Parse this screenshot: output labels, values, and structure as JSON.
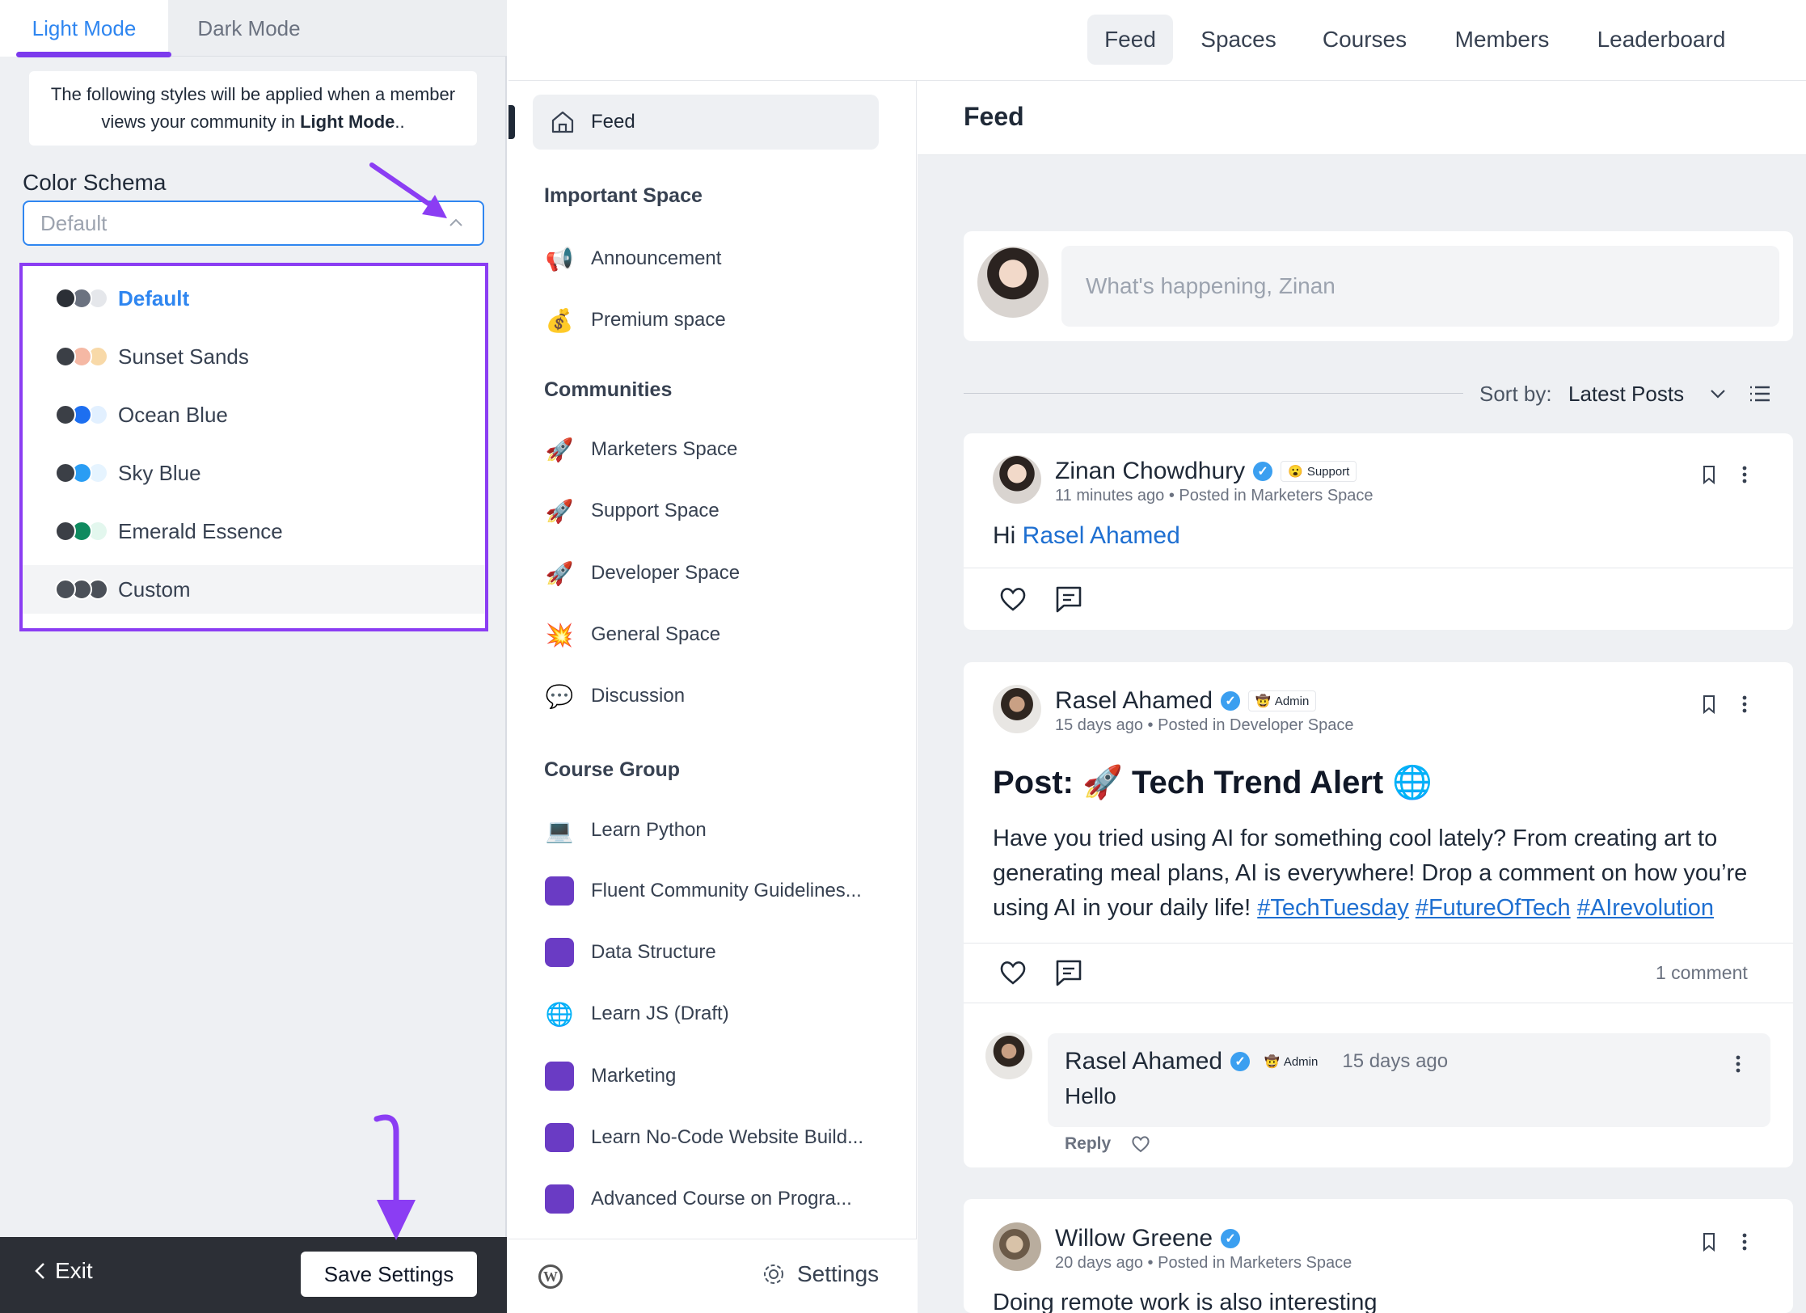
{
  "left_panel": {
    "tabs": [
      "Light Mode",
      "Dark Mode"
    ],
    "info_text": "The following styles will be applied when a member views your community in ",
    "info_bold": "Light Mode",
    "info_suffix": "..",
    "schema_label": "Color Schema",
    "schema_placeholder": "Default",
    "options": [
      {
        "label": "Default",
        "colors": [
          "#2b2f36",
          "#6b7280",
          "#e5e7eb"
        ],
        "selected": true
      },
      {
        "label": "Sunset Sands",
        "colors": [
          "#3b3f46",
          "#f5b8a4",
          "#f8d9a8"
        ]
      },
      {
        "label": "Ocean Blue",
        "colors": [
          "#3b3f46",
          "#1d6ff0",
          "#e2f0ff"
        ]
      },
      {
        "label": "Sky Blue",
        "colors": [
          "#3b3f46",
          "#2a9df4",
          "#e6f4ff"
        ]
      },
      {
        "label": "Emerald Essence",
        "colors": [
          "#3b3f46",
          "#0f8a5f",
          "#e3f7ee"
        ]
      },
      {
        "label": "Custom",
        "colors": [
          "#4b5058",
          "#4b5058",
          "#4b5058"
        ],
        "highlighted": true
      }
    ],
    "exit_label": "Exit",
    "save_label": "Save Settings",
    "accent": "#7c3aed"
  },
  "topnav": {
    "items": [
      "Feed",
      "Spaces",
      "Courses",
      "Members",
      "Leaderboard"
    ],
    "active": "Feed"
  },
  "sidebar": {
    "feed_label": "Feed",
    "important_heading": "Important Space",
    "important": [
      {
        "label": "Announcement",
        "icon": "📢"
      },
      {
        "label": "Premium space",
        "icon": "💰"
      }
    ],
    "communities_heading": "Communities",
    "communities": [
      {
        "label": "Marketers Space",
        "icon": "🚀"
      },
      {
        "label": "Support Space",
        "icon": "🚀"
      },
      {
        "label": "Developer Space",
        "icon": "🚀"
      },
      {
        "label": "General Space",
        "icon": "💥"
      },
      {
        "label": "Discussion",
        "icon": "💬"
      }
    ],
    "course_heading": "Course Group",
    "courses": [
      {
        "label": "Learn Python",
        "icon": "💻"
      },
      {
        "label": "Fluent Community Guidelines...",
        "icon": "square"
      },
      {
        "label": "Data Structure",
        "icon": "square"
      },
      {
        "label": "Learn JS (Draft)",
        "icon": "🌐"
      },
      {
        "label": "Marketing",
        "icon": "square"
      },
      {
        "label": "Learn No-Code Website Build...",
        "icon": "square"
      },
      {
        "label": "Advanced Course on Progra...",
        "icon": "square"
      }
    ],
    "settings_label": "Settings"
  },
  "feed": {
    "title": "Feed",
    "composer_placeholder": "What's happening, Zinan",
    "sort_label": "Sort by:",
    "sort_value": "Latest Posts",
    "posts": [
      {
        "author": "Zinan Chowdhury",
        "badge": "Support",
        "time": "11 minutes ago",
        "space": "Posted in Marketers Space",
        "greeting": "Hi ",
        "mention": "Rasel Ahamed"
      },
      {
        "author": "Rasel Ahamed",
        "badge": "Admin",
        "time": "15 days ago",
        "space": "Posted in Developer Space",
        "title_prefix": "Post: ",
        "title_text": "Tech Trend Alert",
        "body": "Have you tried using AI for something cool lately? From creating art to generating meal plans, AI is everywhere! Drop a comment on how you’re using AI in your daily life! ",
        "tags": [
          "#TechTuesday",
          "#FutureOfTech",
          "#AIrevolution"
        ],
        "comment_count": "1 comment",
        "comment": {
          "author": "Rasel Ahamed",
          "badge": "Admin",
          "time": "15 days ago",
          "text": "Hello",
          "reply": "Reply"
        }
      },
      {
        "author": "Willow Greene",
        "time": "20 days ago",
        "space": "Posted in Marketers Space",
        "body": "Doing remote work is also interesting"
      }
    ]
  }
}
